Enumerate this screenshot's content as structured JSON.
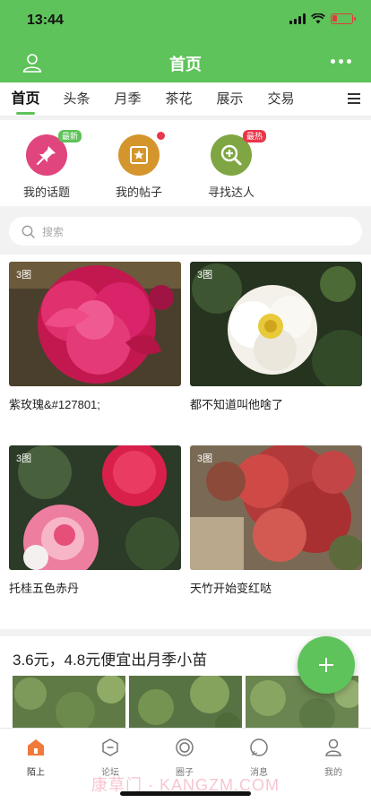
{
  "status": {
    "time": "13:44"
  },
  "header": {
    "title": "首页"
  },
  "tabs": [
    "首页",
    "头条",
    "月季",
    "茶花",
    "展示",
    "交易"
  ],
  "shortcuts": [
    {
      "label": "我的话题",
      "badge": "最新",
      "icon": "pin-icon",
      "color": "#e0457e"
    },
    {
      "label": "我的帖子",
      "badge": "",
      "icon": "star-icon",
      "color": "#d4962c"
    },
    {
      "label": "寻找达人",
      "badge": "最热",
      "icon": "search-plus-icon",
      "color": "#7fa643"
    }
  ],
  "search": {
    "placeholder": "搜索"
  },
  "posts": [
    {
      "count": "3图",
      "title": "紫玫瑰&#127801;"
    },
    {
      "count": "3图",
      "title": "都不知道叫他啥了"
    },
    {
      "count": "3图",
      "title": "托桂五色赤丹"
    },
    {
      "count": "3图",
      "title": "天竹开始变红哒"
    }
  ],
  "promo": {
    "title": "3.6元，4.8元便宜出月季小苗"
  },
  "bottom_nav": [
    "陌上",
    "论坛",
    "圈子",
    "消息",
    "我的"
  ],
  "watermark": "康草门 · KANGZM.COM",
  "colors": {
    "brand_green": "#5ec35a",
    "badge_green": "#5ec35a",
    "badge_red": "#e8374a"
  }
}
